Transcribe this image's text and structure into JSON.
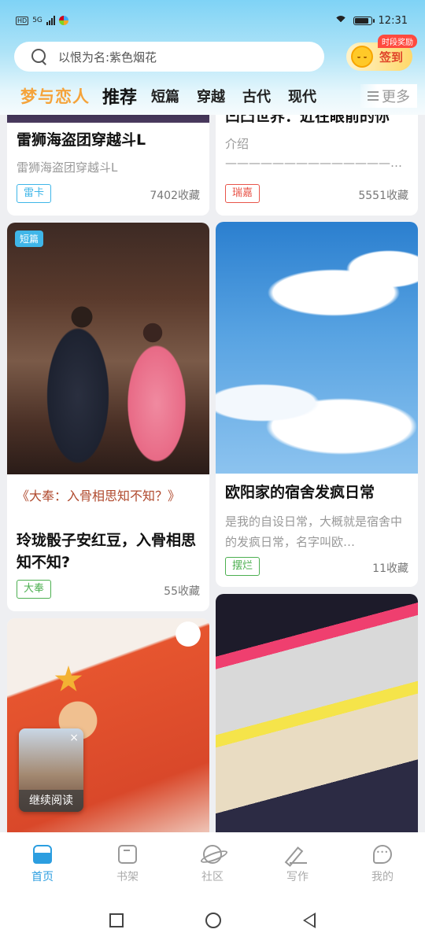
{
  "status_bar": {
    "network": "5G",
    "hd": "HD",
    "time": "12:31"
  },
  "search": {
    "placeholder": "以恨为名:紫色烟花"
  },
  "checkin": {
    "label": "签到",
    "badge": "时段奖励"
  },
  "tabs": {
    "brand": "梦与恋人",
    "items": [
      "推荐",
      "短篇",
      "穿越",
      "古代",
      "现代"
    ],
    "more": "更多"
  },
  "cards": [
    {
      "title": "雷狮海盗团穿越斗L",
      "desc": "雷狮海盗团穿越斗L",
      "tag": "雷卡",
      "tag_color": "#3fb6e8",
      "favs": "7402收藏"
    },
    {
      "title": "凹凸世界：近在眼前的你",
      "desc": "介绍",
      "desc2": "——————————————…",
      "tag": "瑞嘉",
      "tag_color": "#e8554a",
      "favs": "5551收藏"
    },
    {
      "corner": "短篇",
      "quote": "《大奉：入骨相思知不知？》",
      "title": "玲珑骰子安红豆，入骨相思知不知?",
      "tag": "大奉",
      "tag_color": "#4caf50",
      "favs": "55收藏"
    },
    {
      "title": "欧阳家的宿舍发疯日常",
      "desc": "是我的自设日常，大概就是宿舍中的发疯日常，名字叫欧…",
      "tag": "摆烂",
      "tag_color": "#4caf50",
      "favs": "11收藏"
    }
  ],
  "continue_reading": {
    "label": "继续阅读"
  },
  "bottom_nav": [
    {
      "label": "首页",
      "icon": "home-icon",
      "active": true
    },
    {
      "label": "书架",
      "icon": "bookshelf-icon"
    },
    {
      "label": "社区",
      "icon": "community-icon"
    },
    {
      "label": "写作",
      "icon": "write-icon"
    },
    {
      "label": "我的",
      "icon": "profile-icon"
    }
  ],
  "colors": {
    "accent": "#2c9ee0",
    "brand": "#f5a33a"
  }
}
